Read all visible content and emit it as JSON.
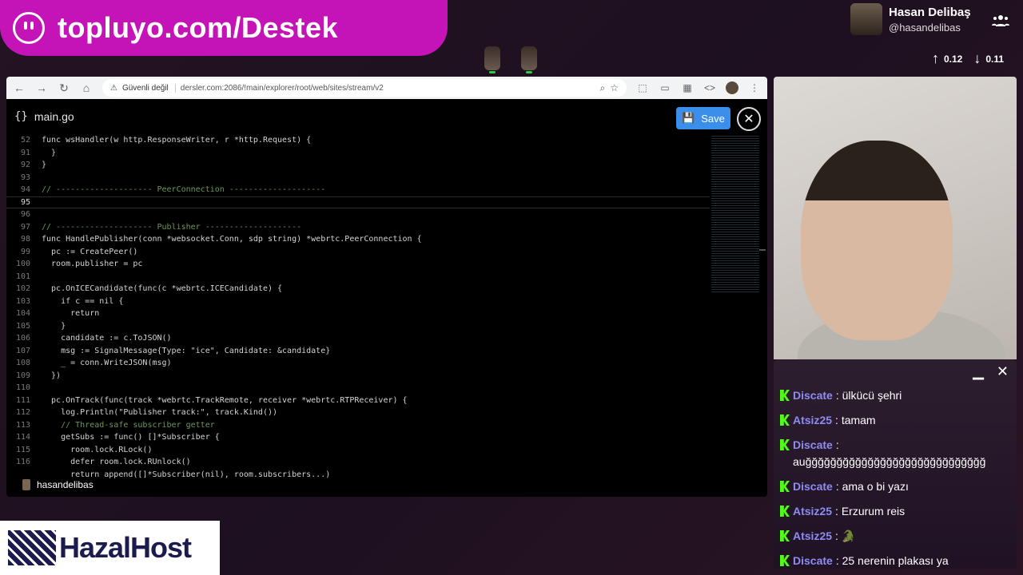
{
  "banner": {
    "title": "topluyo.com/Destek"
  },
  "profile": {
    "name": "Hasan Delibaş",
    "handle": "@hasandelibas"
  },
  "network": {
    "up": "0.12",
    "down": "0.11"
  },
  "browser": {
    "security_label": "Güvenli değil",
    "url": "dersler.com:2086/!main/explorer/root/web/sites/stream/v2"
  },
  "editor": {
    "filename": "main.go",
    "save_label": "Save",
    "lines": [
      {
        "n": "52",
        "t": "func wsHandler(w http.ResponseWriter, r *http.Request) {"
      },
      {
        "n": "91",
        "t": "  }"
      },
      {
        "n": "92",
        "t": "}"
      },
      {
        "n": "93",
        "t": ""
      },
      {
        "n": "94",
        "t": "// -------------------- PeerConnection --------------------"
      },
      {
        "n": "95",
        "t": ""
      },
      {
        "n": "96",
        "t": ""
      },
      {
        "n": "97",
        "t": "// -------------------- Publisher --------------------"
      },
      {
        "n": "98",
        "t": "func HandlePublisher(conn *websocket.Conn, sdp string) *webrtc.PeerConnection {"
      },
      {
        "n": "99",
        "t": "  pc := CreatePeer()"
      },
      {
        "n": "100",
        "t": "  room.publisher = pc"
      },
      {
        "n": "101",
        "t": ""
      },
      {
        "n": "102",
        "t": "  pc.OnICECandidate(func(c *webrtc.ICECandidate) {"
      },
      {
        "n": "103",
        "t": "    if c == nil {"
      },
      {
        "n": "104",
        "t": "      return"
      },
      {
        "n": "105",
        "t": "    }"
      },
      {
        "n": "106",
        "t": "    candidate := c.ToJSON()"
      },
      {
        "n": "107",
        "t": "    msg := SignalMessage{Type: \"ice\", Candidate: &candidate}"
      },
      {
        "n": "108",
        "t": "    _ = conn.WriteJSON(msg)"
      },
      {
        "n": "109",
        "t": "  })"
      },
      {
        "n": "110",
        "t": ""
      },
      {
        "n": "111",
        "t": "  pc.OnTrack(func(track *webrtc.TrackRemote, receiver *webrtc.RTPReceiver) {"
      },
      {
        "n": "112",
        "t": "    log.Println(\"Publisher track:\", track.Kind())"
      },
      {
        "n": "113",
        "t": "    // Thread-safe subscriber getter"
      },
      {
        "n": "114",
        "t": "    getSubs := func() []*Subscriber {"
      },
      {
        "n": "115",
        "t": "      room.lock.RLock()"
      },
      {
        "n": "116",
        "t": "      defer room.lock.RUnlock()"
      },
      {
        "n": "",
        "t": "      return append([]*Subscriber(nil), room.subscribers...)"
      }
    ],
    "stream_user": "hasandelibas"
  },
  "chat": {
    "messages": [
      {
        "user": "Discate",
        "text": "ülkücü şehri"
      },
      {
        "user": "Atsiz25",
        "text": "tamam"
      },
      {
        "user": "Discate",
        "text": "auğğğğğğğğğğğğğğğğğğğğğğğğğğğğğ"
      },
      {
        "user": "Discate",
        "text": "ama o bi yazı"
      },
      {
        "user": "Atsiz25",
        "text": "Erzurum reis"
      },
      {
        "user": "Atsiz25",
        "text": "🐊"
      },
      {
        "user": "Discate",
        "text": "25 nerenin plakası ya"
      }
    ]
  },
  "sponsor": {
    "name": "HazalHost"
  }
}
